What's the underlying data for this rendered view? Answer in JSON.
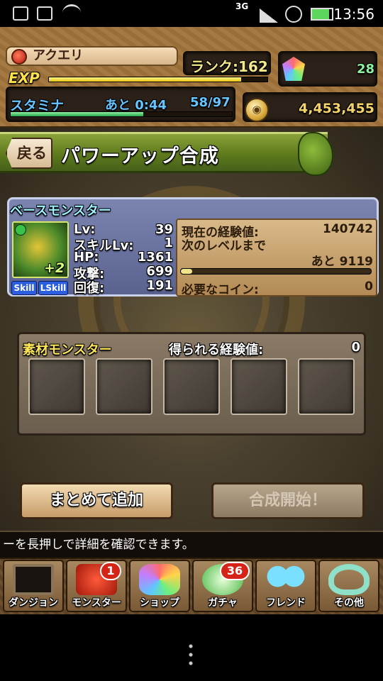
{
  "status_bar": {
    "network": "3G",
    "time": "13:56"
  },
  "player": {
    "name": "アクエリ",
    "rank_label": "ランク:162",
    "exp_label": "EXP",
    "exp_fraction": 0.88,
    "stamina_label": "スタミナ",
    "stamina_timer": "あと 0:44",
    "stamina_value": "58/97",
    "stamina_fraction": 0.6,
    "magic_stones": "28",
    "coins": "4,453,455"
  },
  "header": {
    "back_label": "戻る",
    "title": "パワーアップ合成"
  },
  "base_monster": {
    "section_label": "ベースモンスター",
    "plus_value": "+2",
    "skill_badge": "Skill",
    "lskill_badge": "LSkill",
    "stats": [
      {
        "label": "Lv:",
        "value": "39"
      },
      {
        "label": "スキルLv:",
        "value": "1"
      },
      {
        "label": "HP:",
        "value": "1361"
      },
      {
        "label": "攻撃:",
        "value": "699"
      },
      {
        "label": "回復:",
        "value": "191"
      }
    ],
    "current_exp_label": "現在の経験値:",
    "current_exp_value": "140742",
    "next_level_label": "次のレベルまで",
    "next_level_value": "あと 9119",
    "next_level_fraction": 0.06,
    "required_coins_label": "必要なコイン:",
    "required_coins_value": "0"
  },
  "material": {
    "section_label": "素材モンスター",
    "exp_label": "得られる経験値:",
    "exp_value": "0",
    "slot_count": 5
  },
  "buttons": {
    "bulk_add": "まとめて追加",
    "start_fusion": "合成開始！"
  },
  "tip_text": "ーを長押しで詳細を確認できます。",
  "nav": [
    {
      "label": "ダンジョン",
      "icon": "dungeon-gate-icon",
      "badge": ""
    },
    {
      "label": "モンスター",
      "icon": "red-dragon-icon",
      "badge": "1"
    },
    {
      "label": "ショップ",
      "icon": "magic-stone-icon",
      "badge": ""
    },
    {
      "label": "ガチャ",
      "icon": "egg-icon",
      "badge": "36"
    },
    {
      "label": "フレンド",
      "icon": "friends-icon",
      "badge": ""
    },
    {
      "label": "その他",
      "icon": "question-mark-icon",
      "badge": ""
    }
  ],
  "colors": {
    "title_green": "#5e7a1c",
    "stat_blue": "#67c4ff",
    "coin_gold": "#f3d36a",
    "badge_red": "#d62318"
  }
}
